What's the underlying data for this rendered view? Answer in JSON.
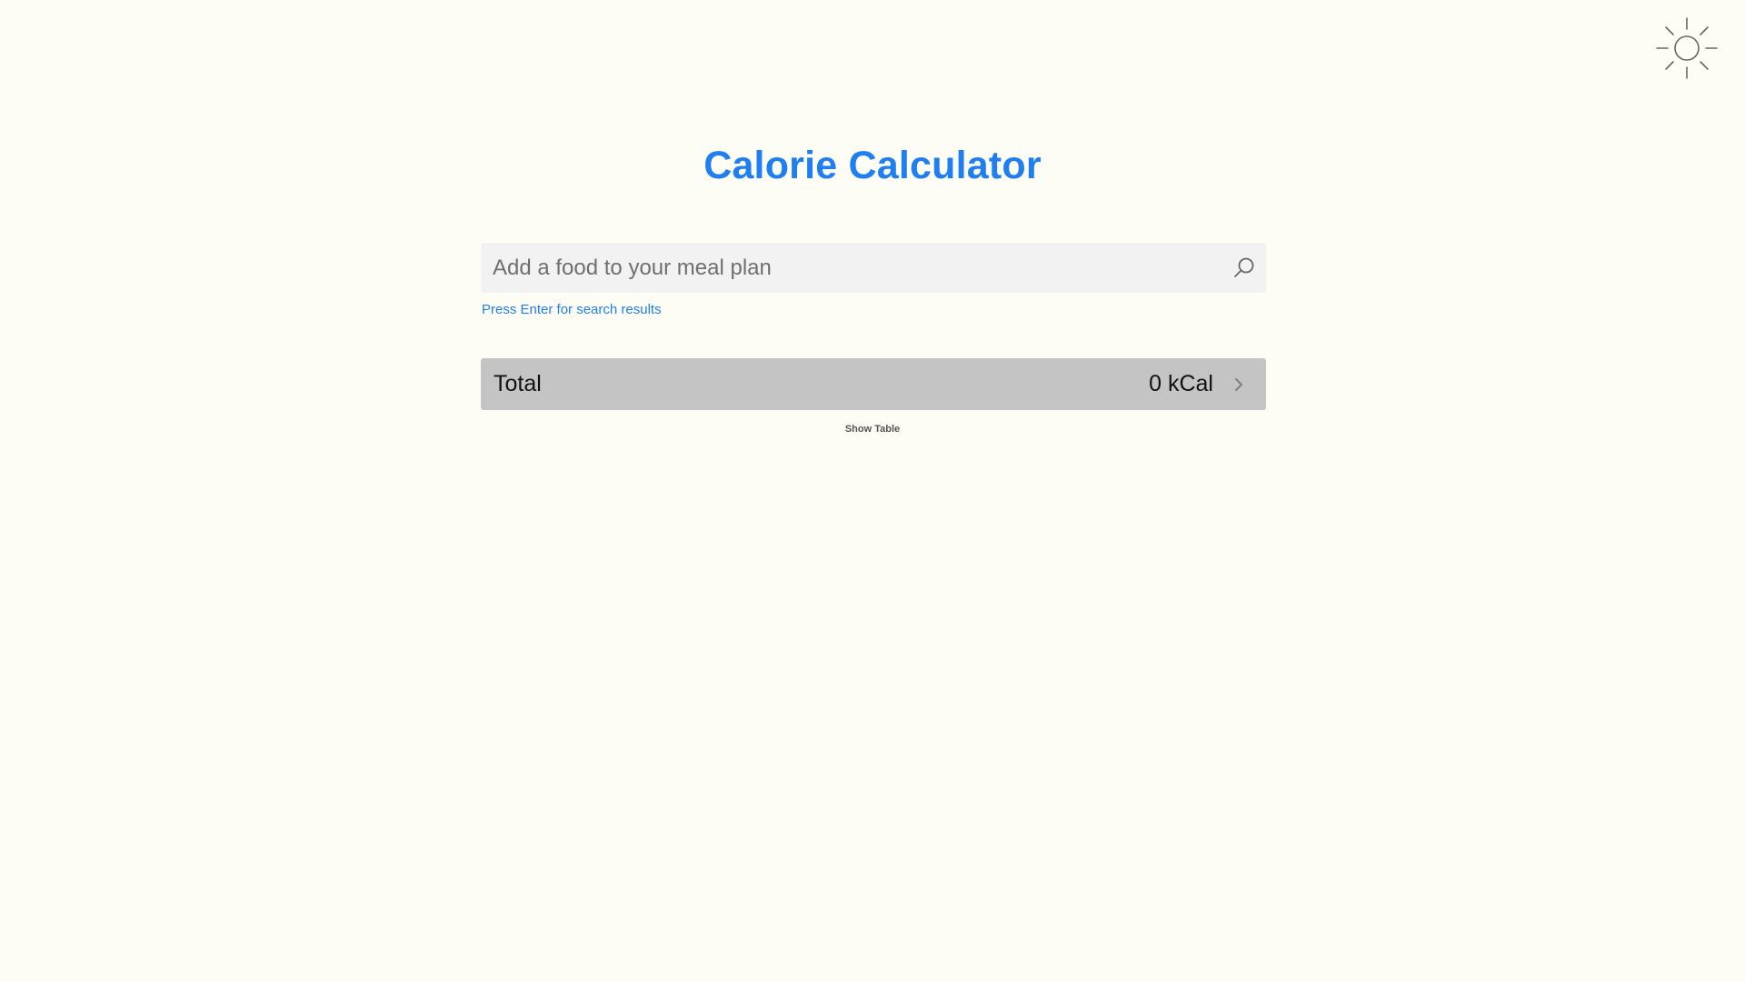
{
  "header": {
    "theme_toggle_icon": "sun-icon"
  },
  "main": {
    "title": "Calorie Calculator",
    "search": {
      "placeholder": "Add a food to your meal plan",
      "value": "",
      "icon": "search-icon",
      "hint": "Press Enter for search results"
    },
    "total": {
      "label": "Total",
      "value": "0 kCal",
      "icon": "chevron-right-icon"
    },
    "show_table_label": "Show Table"
  },
  "colors": {
    "background": "#fdfdf5",
    "accent": "#1f7ff0",
    "search_background": "#f2f2f2",
    "total_bar_background": "#c4c4c4"
  }
}
